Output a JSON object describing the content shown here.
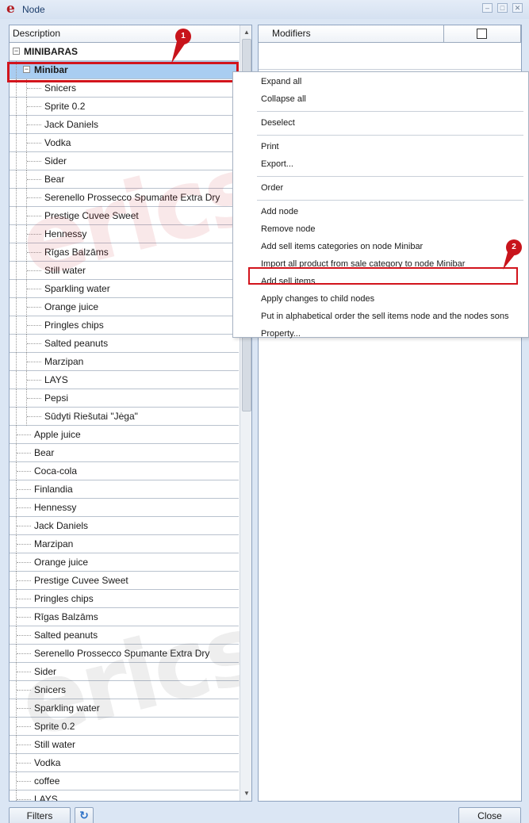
{
  "window": {
    "title": "Node",
    "logo_letter": "e",
    "controls": [
      "–",
      "□",
      "✕"
    ]
  },
  "tree": {
    "header": "Description",
    "rows": [
      {
        "label": "MINIBARAS",
        "level": 0,
        "expander": "−",
        "bold": true
      },
      {
        "label": "Minibar",
        "level": 1,
        "expander": "−",
        "bold": true,
        "selected": true
      },
      {
        "label": "Snicers",
        "level": 2
      },
      {
        "label": "Sprite 0.2",
        "level": 2
      },
      {
        "label": "Jack Daniels",
        "level": 2
      },
      {
        "label": "Vodka",
        "level": 2
      },
      {
        "label": "Sider",
        "level": 2
      },
      {
        "label": "Bear",
        "level": 2
      },
      {
        "label": "Serenello Prossecco Spumante Extra Dry",
        "level": 2
      },
      {
        "label": "Prestige Cuvee Sweet",
        "level": 2
      },
      {
        "label": "Hennessy",
        "level": 2
      },
      {
        "label": "Rīgas Balzāms",
        "level": 2
      },
      {
        "label": "Still water",
        "level": 2
      },
      {
        "label": "Sparkling water",
        "level": 2
      },
      {
        "label": "Orange juice",
        "level": 2
      },
      {
        "label": "Pringles chips",
        "level": 2
      },
      {
        "label": "Salted peanuts",
        "level": 2
      },
      {
        "label": "Marzipan",
        "level": 2
      },
      {
        "label": "LAYS",
        "level": 2
      },
      {
        "label": "Pepsi",
        "level": 2
      },
      {
        "label": "Sūdyti Riešutai \"Jėga\"",
        "level": 2
      },
      {
        "label": "Apple juice",
        "level": 1
      },
      {
        "label": "Bear",
        "level": 1
      },
      {
        "label": "Coca-cola",
        "level": 1
      },
      {
        "label": "Finlandia",
        "level": 1
      },
      {
        "label": "Hennessy",
        "level": 1
      },
      {
        "label": "Jack Daniels",
        "level": 1
      },
      {
        "label": "Marzipan",
        "level": 1
      },
      {
        "label": "Orange juice",
        "level": 1
      },
      {
        "label": "Prestige Cuvee Sweet",
        "level": 1
      },
      {
        "label": "Pringles chips",
        "level": 1
      },
      {
        "label": "Rīgas Balzāms",
        "level": 1
      },
      {
        "label": "Salted peanuts",
        "level": 1
      },
      {
        "label": "Serenello Prossecco Spumante Extra Dry",
        "level": 1
      },
      {
        "label": "Sider",
        "level": 1
      },
      {
        "label": "Snicers",
        "level": 1
      },
      {
        "label": "Sparkling water",
        "level": 1
      },
      {
        "label": "Sprite 0.2",
        "level": 1
      },
      {
        "label": "Still water",
        "level": 1
      },
      {
        "label": "Vodka",
        "level": 1
      },
      {
        "label": "coffee",
        "level": 1
      },
      {
        "label": "LAYS",
        "level": 1
      }
    ]
  },
  "modifiers": {
    "header": "Modifiers"
  },
  "context_menu": {
    "groups": [
      [
        "Expand all",
        "Collapse all"
      ],
      [
        "Deselect"
      ],
      [
        "Print",
        "Export..."
      ],
      [
        "Order"
      ],
      [
        "Add node",
        "Remove node",
        "Add sell items categories on node Minibar",
        "Import all product from sale category to node Minibar",
        "Add sell items",
        "Apply changes to child nodes",
        "Put in alphabetical order the sell items node and the nodes sons",
        "Property..."
      ]
    ]
  },
  "callouts": [
    "1",
    "2"
  ],
  "watermark": "ericsoft",
  "bottom": {
    "filters_label": "Filters",
    "close_label": "Close",
    "refresh_icon": "↻"
  },
  "colors": {
    "accent_red": "#d2141c",
    "selection": "#a9cdf1",
    "frame": "#dbe6f4"
  }
}
